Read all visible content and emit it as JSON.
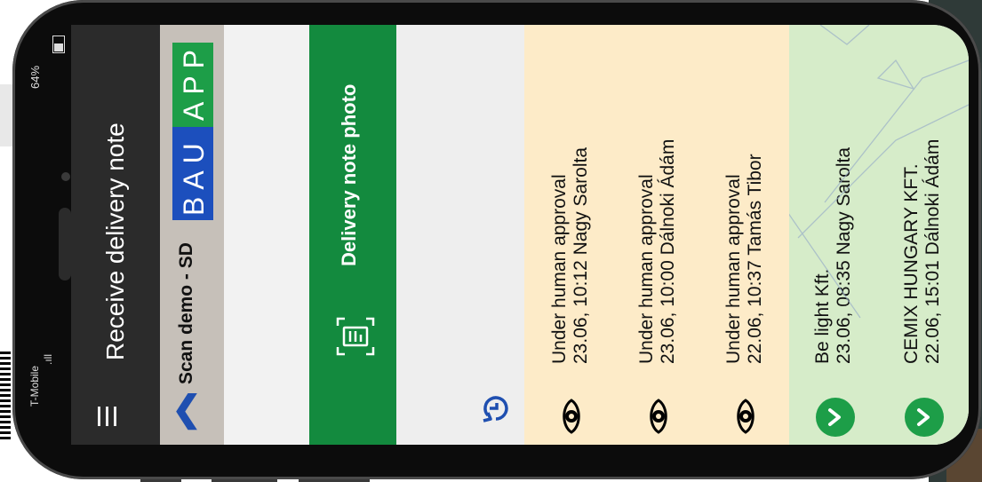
{
  "status_bar": {
    "carrier": "T-Mobile",
    "signal": ".ıll",
    "battery": "64%"
  },
  "app": {
    "title": "Receive delivery note",
    "project": "Scan demo - SD",
    "logo_left": "BAU",
    "logo_right": "APP",
    "photo_button": "Delivery note photo"
  },
  "items": [
    {
      "status": "Under human approval",
      "meta": "23.06, 10:12 Nagy Sarolta",
      "icon": "eye-icon"
    },
    {
      "status": "Under human approval",
      "meta": "23.06, 10:00 Dálnoki Ádám",
      "icon": "eye-icon"
    },
    {
      "status": "Under human approval",
      "meta": "22.06, 10:37 Tamás Tibor",
      "icon": "eye-icon"
    },
    {
      "status": "Be light Kft.",
      "meta": "23.06, 08:35 Nagy Sarolta",
      "icon": "check-icon"
    },
    {
      "status": "CEMIX HUNGARY KFT.",
      "meta": "22.06, 15:01 Dálnoki Ádám",
      "icon": "check-icon"
    }
  ],
  "colors": {
    "appbar": "#2b2b2b",
    "accent_green": "#138a3e",
    "pending_bg": "#fdebc8",
    "done_bg": "#d6ecc9",
    "brand_blue": "#1c4fbd"
  }
}
